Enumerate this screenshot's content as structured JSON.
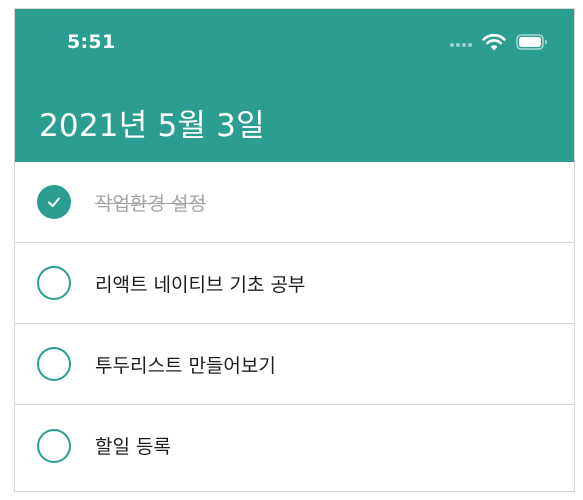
{
  "status_bar": {
    "time": "5:51",
    "icons": [
      "cellular-dots-icon",
      "wifi-icon",
      "battery-icon"
    ]
  },
  "header": {
    "title": "2021년 5월 3일"
  },
  "todos": [
    {
      "text": "작업환경 설정",
      "done": true
    },
    {
      "text": "리액트 네이티브 기초 공부",
      "done": false
    },
    {
      "text": "투두리스트 만들어보기",
      "done": false
    },
    {
      "text": "할일 등록",
      "done": false
    }
  ],
  "colors": {
    "accent": "#2b9e91",
    "done_text": "#a3a3a3",
    "text": "#1d1d1d",
    "divider": "#d9d9d9"
  }
}
